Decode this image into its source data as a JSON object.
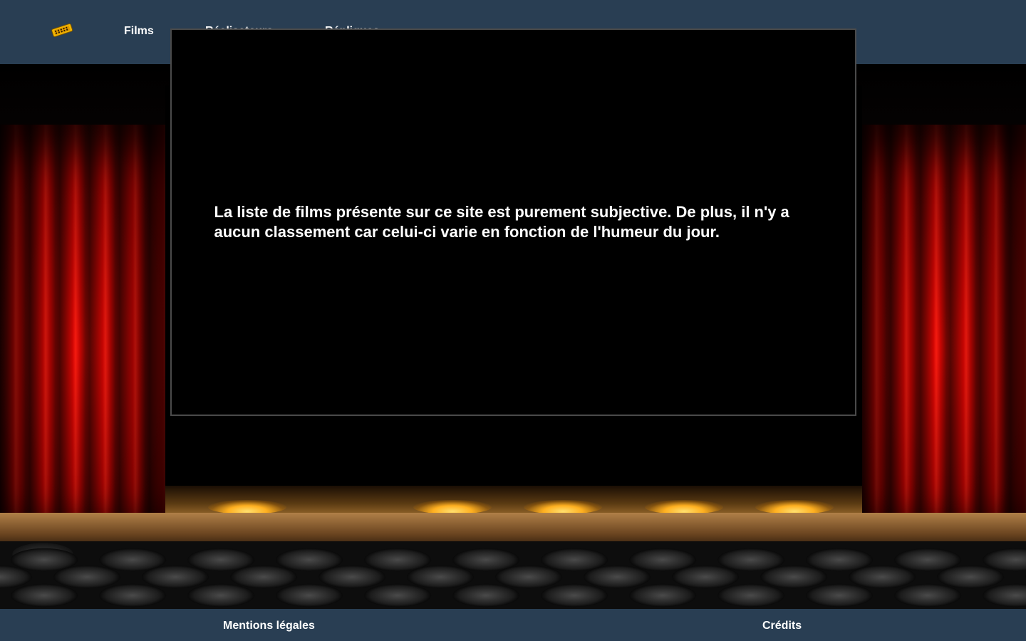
{
  "header": {
    "logo_icon": "film-ticket-icon",
    "nav": [
      {
        "label": "Films"
      },
      {
        "label": "Réalisateurs"
      },
      {
        "label": "Répliques"
      }
    ]
  },
  "main": {
    "screen_text": "La liste de films présente sur ce site est purement subjective. De plus, il n'y a aucun classement car celui-ci varie en fonction de l'humeur du jour."
  },
  "footer": {
    "links": [
      {
        "label": "Mentions légales"
      },
      {
        "label": "Crédits"
      }
    ]
  },
  "colors": {
    "bar_background": "#293e53",
    "text": "#ffffff",
    "curtain": "#d40000",
    "screen": "#000000"
  }
}
